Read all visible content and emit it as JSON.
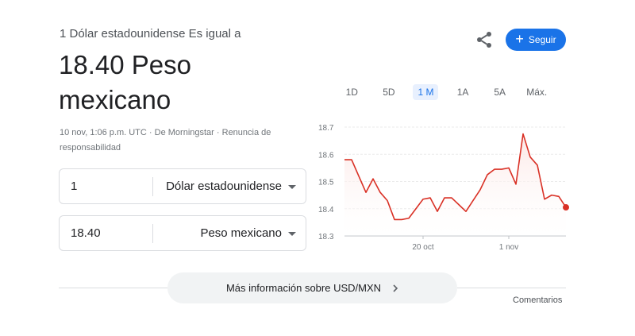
{
  "header": {
    "subtitle": "1 Dólar estadounidense Es igual a",
    "result": "18.40 Peso mexicano",
    "timestamp": "10 nov, 1:06 p.m. UTC",
    "source": "De Morningstar",
    "disclaimer": "Renuncia de responsabilidad",
    "follow_label": "Seguir",
    "share_icon": "share-icon"
  },
  "converter": {
    "from": {
      "amount": "1",
      "unit": "Dólar estadounidense"
    },
    "to": {
      "amount": "18.40",
      "unit": "Peso mexicano"
    }
  },
  "ranges": [
    {
      "label": "1D",
      "active": false
    },
    {
      "label": "5D",
      "active": false
    },
    {
      "label": "1 M",
      "active": true
    },
    {
      "label": "1A",
      "active": false
    },
    {
      "label": "5A",
      "active": false
    },
    {
      "label": "Máx.",
      "active": false
    }
  ],
  "chart_data": {
    "type": "area",
    "y_ticks": [
      "18.7",
      "18.6",
      "18.5",
      "18.4",
      "18.3"
    ],
    "ylim": [
      18.3,
      18.7
    ],
    "x_ticks": [
      {
        "label": "20 oct",
        "index": 11
      },
      {
        "label": "1 nov",
        "index": 23
      }
    ],
    "values": [
      18.58,
      18.58,
      18.52,
      18.46,
      18.51,
      18.46,
      18.43,
      18.36,
      18.36,
      18.365,
      18.4,
      18.435,
      18.44,
      18.39,
      18.44,
      18.44,
      18.415,
      18.39,
      18.43,
      18.47,
      18.525,
      18.545,
      18.545,
      18.55,
      18.49,
      18.675,
      18.59,
      18.56,
      18.435,
      18.45,
      18.445,
      18.405
    ],
    "line_color": "#d93025",
    "fill_color": "#fce8e6",
    "grid": true
  },
  "footer": {
    "more_info": "Más información sobre USD/MXN",
    "feedback": "Comentarios"
  }
}
